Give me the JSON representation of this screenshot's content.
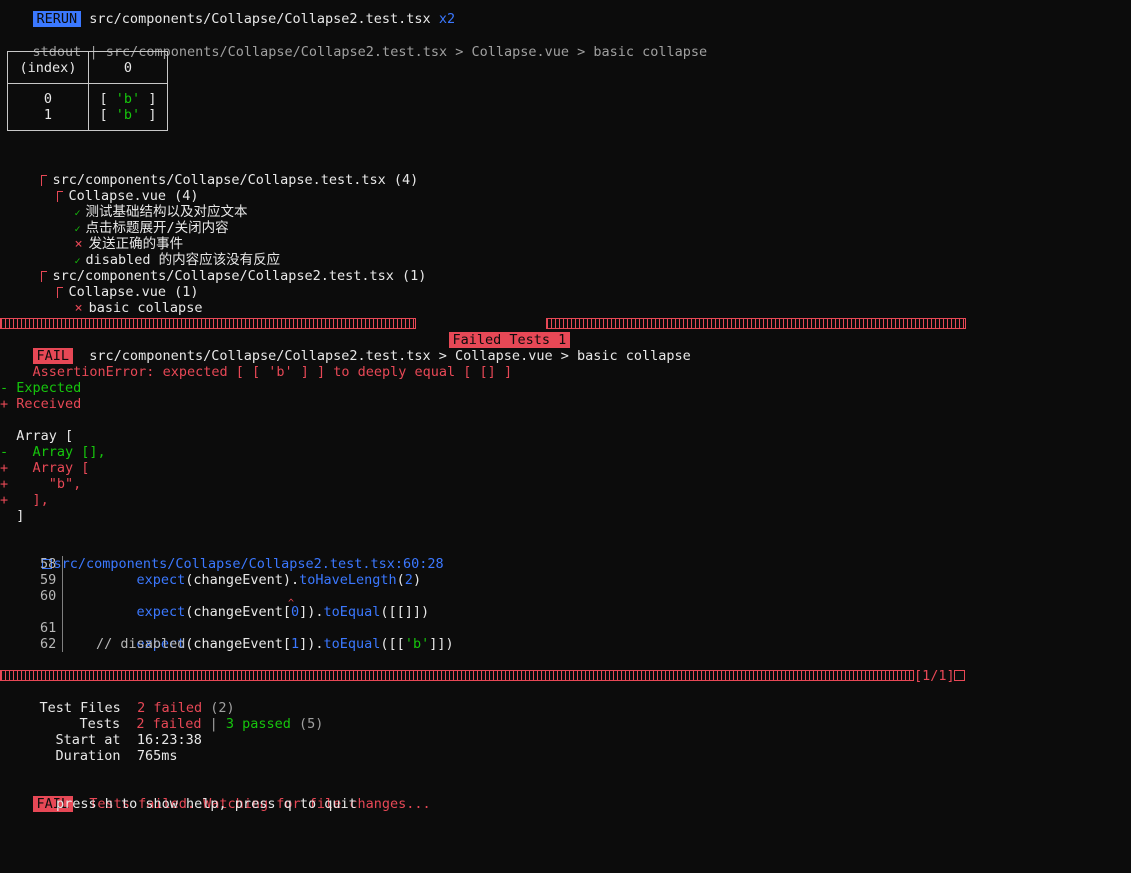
{
  "header": {
    "rerun_badge": "RERUN",
    "file": "src/components/Collapse/Collapse2.test.tsx",
    "count": "x2"
  },
  "stdout": {
    "prefix": "stdout",
    "sep": "|",
    "path": "src/components/Collapse/Collapse2.test.tsx > Collapse.vue > basic collapse",
    "table": {
      "headers": [
        "(index)",
        "0"
      ],
      "indexes": [
        "0",
        "1"
      ],
      "open": [
        "[",
        "["
      ],
      "values": [
        "'b'",
        "'b'"
      ],
      "close": [
        "]",
        "]"
      ]
    }
  },
  "tree": {
    "suite1": "src/components/Collapse/Collapse.test.tsx (4)",
    "suite1_group": "Collapse.vue (4)",
    "suite1_tests": [
      {
        "status": "pass",
        "label": "测试基础结构以及对应文本"
      },
      {
        "status": "pass",
        "label": "点击标题展开/关闭内容"
      },
      {
        "status": "fail",
        "label": "发送正确的事件"
      },
      {
        "status": "pass",
        "label": "disabled 的内容应该没有反应"
      }
    ],
    "suite2": "src/components/Collapse/Collapse2.test.tsx (1)",
    "suite2_group": "Collapse.vue (1)",
    "suite2_test": "basic collapse"
  },
  "failed_banner": "Failed Tests 1",
  "failure": {
    "badge": "FAIL",
    "path": "src/components/Collapse/Collapse2.test.tsx > Collapse.vue > basic collapse",
    "error_name": "AssertionError:",
    "error_msg": "expected [ [ 'b' ] ] to deeply equal [ [] ]"
  },
  "diff": {
    "expected": "- Expected",
    "received": "+ Received",
    "lines": [
      {
        "kind": "ctx",
        "text": "  Array ["
      },
      {
        "kind": "minus",
        "text": "-   Array [],"
      },
      {
        "kind": "plus",
        "text": "+   Array ["
      },
      {
        "kind": "plus",
        "text": "+     \"b\","
      },
      {
        "kind": "plus",
        "text": "+   ],"
      },
      {
        "kind": "ctx",
        "text": "  ]"
      }
    ]
  },
  "location": "src/components/Collapse/Collapse2.test.tsx:60:28",
  "code": {
    "l58_num": "58",
    "l59_num": "59",
    "l60_num": "60",
    "l61_num": "61",
    "l62_num": "62",
    "expect": "expect",
    "paren_change": "(changeEvent)",
    "dot": ".",
    "to_have_length": "toHaveLength",
    "two": "2",
    "change_open": "(changeEvent[",
    "zero": "0",
    "one": "1",
    "change_close": "])",
    "to_equal": "toEqual",
    "arg60": "([[]])",
    "arg61_open": "([[",
    "arg61_str": "'b'",
    "arg61_close": "]])",
    "comment": "// disabled",
    "caret": "^"
  },
  "progress_label": "[1/1]",
  "summary": {
    "test_files_label": "Test Files",
    "test_files_failed": "2 failed",
    "test_files_total": "(2)",
    "tests_label": "Tests",
    "tests_failed": "2 failed",
    "tests_sep": "|",
    "tests_passed": "3 passed",
    "tests_total": "(5)",
    "start_label": "Start at",
    "start_value": "16:23:38",
    "duration_label": "Duration",
    "duration_value": "765ms"
  },
  "footer": {
    "badge": "FAIL",
    "message": "Tests failed. Watching for file changes...",
    "help": "press h to show help, press q to quit"
  },
  "colors": {
    "background": "#0c0c0c",
    "red": "#e74856",
    "green": "#16c60c",
    "blue": "#3b78ff"
  }
}
